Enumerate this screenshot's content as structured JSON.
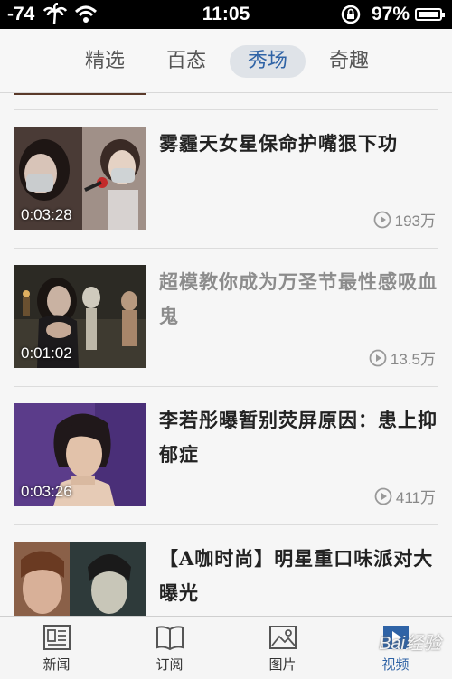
{
  "status_bar": {
    "signal": "-74",
    "time": "11:05",
    "battery_percent": "97%"
  },
  "category_tabs": [
    {
      "label": "精选",
      "active": false
    },
    {
      "label": "百态",
      "active": false
    },
    {
      "label": "秀场",
      "active": true
    },
    {
      "label": "奇趣",
      "active": false
    }
  ],
  "videos": [
    {
      "title": "雾霾天女星保命护嘴狠下功",
      "duration": "0:03:28",
      "views": "193万",
      "read": false
    },
    {
      "title": "超模教你成为万圣节最性感吸血鬼",
      "duration": "0:01:02",
      "views": "13.5万",
      "read": true
    },
    {
      "title": "李若彤曝暂别荧屏原因：患上抑郁症",
      "duration": "0:03:26",
      "views": "411万",
      "read": false
    },
    {
      "title": "【A咖时尚】明星重口味派对大曝光",
      "duration": "",
      "views": "",
      "read": false
    }
  ],
  "tab_bar": [
    {
      "label": "新闻",
      "icon": "news-icon",
      "active": false
    },
    {
      "label": "订阅",
      "icon": "book-icon",
      "active": false
    },
    {
      "label": "图片",
      "icon": "picture-icon",
      "active": false
    },
    {
      "label": "视频",
      "icon": "video-icon",
      "active": true
    }
  ],
  "watermark": "Bai经验",
  "colors": {
    "accent": "#2f63a6",
    "active_tab_bg": "#dfe3e8"
  }
}
